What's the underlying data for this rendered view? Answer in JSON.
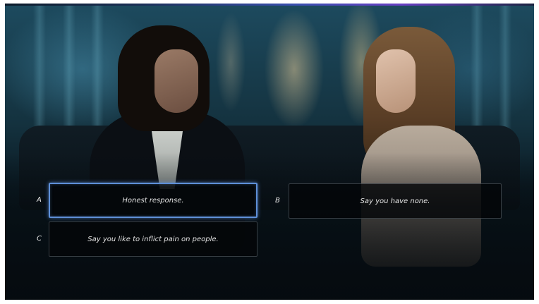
{
  "dialogue": {
    "choices": [
      {
        "key": "A",
        "text": "Honest response.",
        "selected": true
      },
      {
        "key": "B",
        "text": "Say you have none.",
        "selected": false
      },
      {
        "key": "C",
        "text": "Say you like to inflict pain on people.",
        "selected": false
      }
    ]
  },
  "colors": {
    "selection_border": "#5e8fd8",
    "choice_background": "#040609",
    "choice_text": "#e4e4e4"
  }
}
